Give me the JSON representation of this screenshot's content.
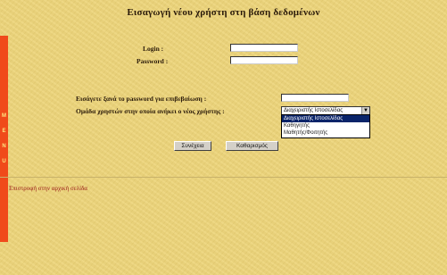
{
  "page": {
    "title": "Εισαγωγή νέου χρήστη στη βάση δεδομένων"
  },
  "menu": {
    "letters": [
      "M",
      "E",
      "N",
      "U"
    ],
    "color": "#f04a1a"
  },
  "form": {
    "login_label": "Login :",
    "password_label": "Password :",
    "login_value": "",
    "password_value": "",
    "confirm_label": "Εισάγετε ξανά το password για επιβεβαίωση :",
    "confirm_value": "",
    "group_label": "Ομάδα χρηστών στην οποία ανήκει ο νέος χρήστης :",
    "group_selected": "Διαχειριστής Ιστοσελίδας",
    "group_options": [
      "Διαχειριστής Ιστοσελίδας",
      "Καθηγητής",
      "Μαθητής/Φοιτητής"
    ]
  },
  "buttons": {
    "submit": "Συνέχεια",
    "reset": "Καθαρισμός"
  },
  "footer": {
    "back_link": "Επιστροφή στην αρχική σελίδα"
  }
}
